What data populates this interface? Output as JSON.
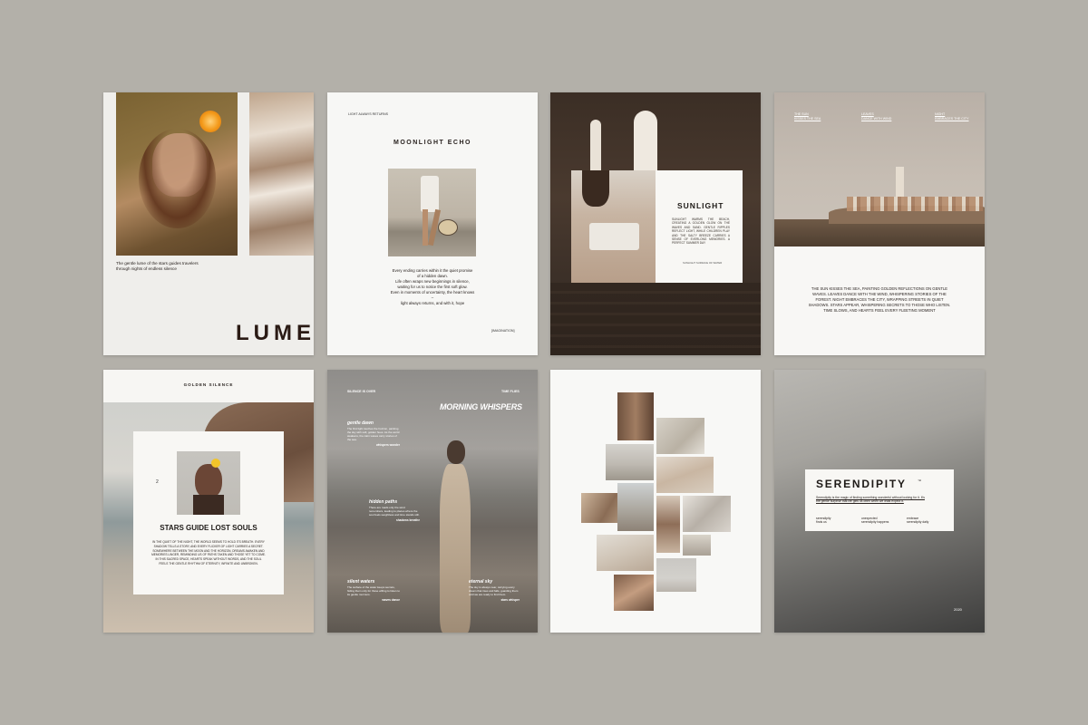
{
  "pages": {
    "lume": {
      "caption": "The gentle lume of the stars guides travelers through nights of endless silence",
      "title": "LUME"
    },
    "moonlight": {
      "kicker": "LIGHT ALWAYS RETURNS",
      "title": "MOONLIGHT ECHO",
      "poem": [
        "Every ending carries within it the quiet promise",
        "of a hidden dawn.",
        "Life often wraps new beginnings in silence,",
        "waiting for us to notice the first soft glow.",
        "Even in moments of uncertainty, the heart knows",
        "–",
        "light always returns, and with it, hope"
      ],
      "tag": "[IMAGINATION]"
    },
    "sunlight": {
      "title": "SUNLIGHT",
      "body": "SUNLIGHT WARMS THE BEACH, CREATING A GOLDEN GLOW ON THE WAVES AND SAND. GENTLE RIPPLES REFLECT LIGHT, WHILE CHILDREN PLAY AND THE SALTY BREEZE CARRIES A SENSE OF EVERLONG MEMORIES. A PERFECT SUMMER DAY",
      "foot": "SUNLIGHT SURFACE OF WATER"
    },
    "sea": {
      "top": [
        {
          "a": "THE SUN",
          "b": "KISSES THE SEA"
        },
        {
          "a": "LEAVES",
          "b": "DANCE WITH WIND"
        },
        {
          "a": "NIGHT",
          "b": "EMBRACES THE CITY"
        }
      ],
      "body": "THE SUN KISSES THE SEA, PAINTING GOLDEN REFLECTIONS ON GENTLE WAVES. LEAVES DANCE WITH THE WIND, WHISPERING STORIES OF THE FOREST. NIGHT EMBRACES THE CITY, WRAPPING STREETS IN QUIET SHADOWS. STARS APPEAR, WHISPERING SECRETS TO THOSE WHO LISTEN. TIME SLOWS, AND HEARTS FEEL EVERY FLEETING MOMENT"
    },
    "golden": {
      "header": "GOLDEN SILENCE",
      "num": "2",
      "title": "STARS GUIDE LOST SOULS",
      "body": "IN THE QUIET OF THE NIGHT, THE WORLD SEEMS TO HOLD ITS BREATH. EVERY SHADOW TELLS A STORY, AND EVERY FLICKER OF LIGHT CARRIES A SECRET. SOMEWHERE BETWEEN THE MOON AND THE HORIZON, DREAMS AWAKEN AND MEMORIES LINGER, REMINDING US OF PATHS TAKEN AND THOSE YET TO COME. IN THIS SACRED SPACE, HEARTS SPEAK WITHOUT WORDS, AND THE SOUL FEELS THE GENTLE RHYTHM OF ETERNITY, INFINITE AND UNBROKEN."
    },
    "morning": {
      "left_header": "SILENCE IS OVER",
      "right_header": "TIME FLIES",
      "title": "MORNING WHISPERS",
      "items": [
        {
          "title": "gentle dawn",
          "text": "The first light touches the horizon, painting the sky with soft, golden hues. As the world awakens, the calm waves carry stories of the sea.",
          "sub": "whispers wonder"
        },
        {
          "title": "hidden paths",
          "text": "There are roads only the wind remembers, leading to places where the soul feels weightless and time stands still.",
          "sub": "shadows breathe"
        },
        {
          "title": "silent waters",
          "text": "The surface of the water keeps secrets, hiding them only for those willing to listen to its gentle murmurs.",
          "sub": "waves dance"
        },
        {
          "title": "eternal sky",
          "text": "The sky is always near, carrying every dream that rises and falls, guarding them until we are ready to find them.",
          "sub": "stars whisper"
        }
      ]
    },
    "serendipity": {
      "title": "SERENDIPITY",
      "tm": "™",
      "intro": "Serendipity is the magic of finding something wonderful without looking for it. It's the gentle surprise that life gifts us often when we least expect it.",
      "cols": [
        [
          "serendipity",
          "finds us"
        ],
        [
          "unexpected",
          "serendipity happens"
        ],
        [
          "embrace",
          "serendipity daily"
        ]
      ],
      "year": "2020"
    }
  }
}
